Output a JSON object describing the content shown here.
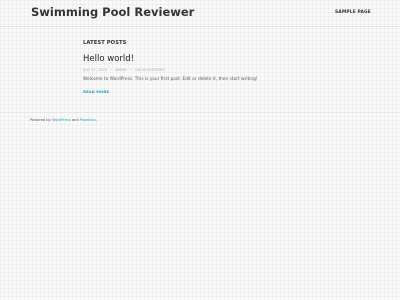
{
  "site": {
    "title": "Swimming Pool Reviewer"
  },
  "nav": {
    "items": [
      {
        "label": "SAMPLE PAGE"
      }
    ]
  },
  "main": {
    "section_heading": "LATEST POSTS",
    "post": {
      "title": "Hello world!",
      "date": "JULY 27, 2018",
      "separator": "•",
      "author": "ADMIN",
      "category": "UNCATEGORIZED",
      "excerpt": "Welcome to WordPress. This is your first post. Edit or delete it, then start writing!",
      "read_more": "READ MORE"
    }
  },
  "footer": {
    "powered_by": "Powered by",
    "wordpress_link": "WordPress",
    "and": "and",
    "theme_link": "Poseidon",
    "period": "."
  },
  "colors": {
    "accent": "#24a0c0",
    "text": "#333333",
    "muted": "#aaaaaa"
  }
}
